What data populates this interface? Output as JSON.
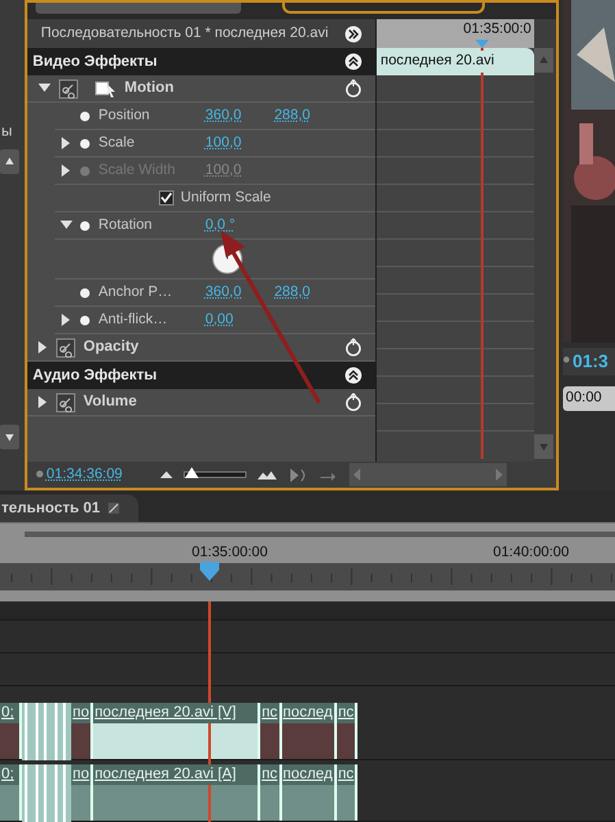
{
  "effect_controls": {
    "header": "Последовательность 01 * последнея 20.avi",
    "ruler_time": "01:35:00:0",
    "clip_name": "последнея 20.avi",
    "sections": [
      {
        "title": "Видео Эффекты",
        "effects": [
          {
            "name": "Motion",
            "expanded": true,
            "properties": [
              {
                "kind": "value",
                "label": "Position",
                "values": [
                  "360,0",
                  "288,0"
                ],
                "expandable": false,
                "disabled": false
              },
              {
                "kind": "value",
                "label": "Scale",
                "values": [
                  "100,0"
                ],
                "expandable": true,
                "disabled": false
              },
              {
                "kind": "value",
                "label": "Scale Width",
                "values": [
                  "100,0"
                ],
                "expandable": true,
                "disabled": true
              },
              {
                "kind": "checkbox",
                "label": "Uniform Scale",
                "checked": true
              },
              {
                "kind": "value",
                "label": "Rotation",
                "values": [
                  "0,0 °"
                ],
                "expandable": true,
                "expanded": true,
                "disabled": false
              },
              {
                "kind": "dial"
              },
              {
                "kind": "value",
                "label": "Anchor P…",
                "values": [
                  "360,0",
                  "288,0"
                ],
                "expandable": false,
                "disabled": false
              },
              {
                "kind": "value",
                "label": "Anti-flick…",
                "values": [
                  "0,00"
                ],
                "expandable": true,
                "disabled": false
              }
            ]
          },
          {
            "name": "Opacity",
            "expanded": false
          }
        ]
      },
      {
        "title": "Аудио Эффекты",
        "effects": [
          {
            "name": "Volume",
            "expanded": false
          }
        ]
      }
    ],
    "timecode": "01:34:36:09",
    "zoom": {
      "level": 0.1
    }
  },
  "side_left": {
    "text": "ы"
  },
  "monitor": {
    "timecode": "01:3",
    "time": "00:00"
  },
  "timeline": {
    "tab": "тельность 01",
    "ruler_labels": [
      "01:35:00:00",
      "01:40:00:00"
    ],
    "video_clips": [
      {
        "label": "0;"
      },
      {
        "label": "по"
      },
      {
        "label": "последнея 20.avi [V]"
      },
      {
        "label": "пс"
      },
      {
        "label": "послед"
      },
      {
        "label": "пс"
      }
    ],
    "audio_clips": [
      {
        "label": "0;"
      },
      {
        "label": "по"
      },
      {
        "label": "последнея 20.avi [A]"
      },
      {
        "label": "пс"
      },
      {
        "label": "послед"
      },
      {
        "label": "пс"
      }
    ]
  }
}
